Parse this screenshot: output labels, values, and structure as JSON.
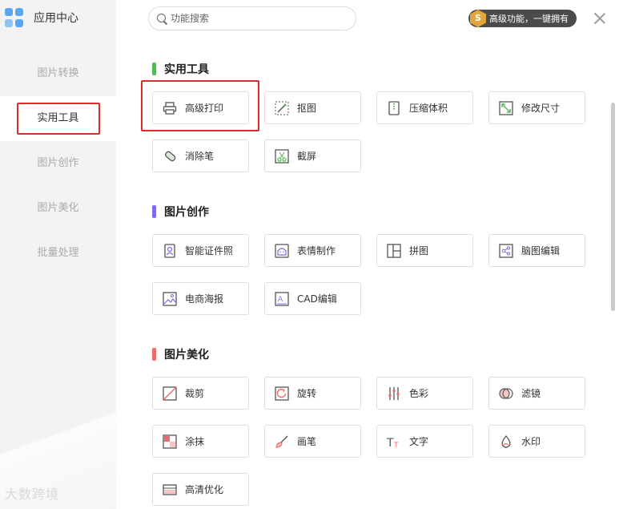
{
  "app": {
    "title": "应用中心"
  },
  "sidebar": {
    "items": [
      {
        "label": "图片转换"
      },
      {
        "label": "实用工具"
      },
      {
        "label": "图片创作"
      },
      {
        "label": "图片美化"
      },
      {
        "label": "批量处理"
      }
    ],
    "active_index": 1,
    "watermark": "大数跨境"
  },
  "search": {
    "placeholder": "功能搜索",
    "value": ""
  },
  "premium": {
    "badge": "S",
    "text": "高级功能，一键拥有"
  },
  "sections": [
    {
      "title": "实用工具",
      "color": "#56b85a",
      "tools": [
        "高级打印",
        "抠图",
        "压缩体积",
        "修改尺寸",
        "消除笔",
        "截屏"
      ]
    },
    {
      "title": "图片创作",
      "color": "#7b6cf0",
      "tools": [
        "智能证件照",
        "表情制作",
        "拼图",
        "脑图编辑",
        "电商海报",
        "CAD编辑"
      ]
    },
    {
      "title": "图片美化",
      "color": "#ee6b6b",
      "tools": [
        "裁剪",
        "旋转",
        "色彩",
        "滤镜",
        "涂抹",
        "画笔",
        "文字",
        "水印",
        "高清优化"
      ]
    }
  ],
  "icons": {
    "高级打印": "printer-icon",
    "抠图": "cutout-icon",
    "压缩体积": "compress-icon",
    "修改尺寸": "resize-icon",
    "消除笔": "eraser-icon",
    "截屏": "screenshot-icon",
    "智能证件照": "id-photo-icon",
    "表情制作": "emoji-icon",
    "拼图": "collage-icon",
    "脑图编辑": "mindmap-icon",
    "电商海报": "poster-icon",
    "CAD编辑": "cad-icon",
    "裁剪": "crop-icon",
    "旋转": "rotate-icon",
    "色彩": "color-adjust-icon",
    "滤镜": "filter-icon",
    "涂抹": "smudge-icon",
    "画笔": "brush-icon",
    "文字": "text-icon",
    "水印": "watermark-icon",
    "高清优化": "hd-enhance-icon"
  }
}
